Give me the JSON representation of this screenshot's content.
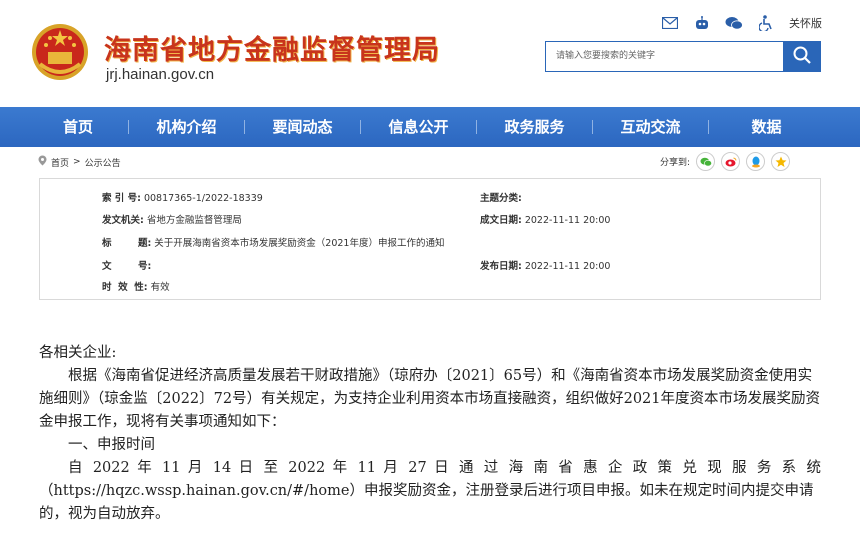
{
  "header": {
    "site_title": "海南省地方金融监督管理局",
    "site_domain": "jrj.hainan.gov.cn",
    "care_label": "关怀版",
    "search_placeholder": "请输入您要搜索的关键字",
    "icons": [
      "mail-icon",
      "robot-icon",
      "wechat-icon",
      "accessibility-icon",
      "search-icon"
    ]
  },
  "nav": {
    "items": [
      "首页",
      "机构介绍",
      "要闻动态",
      "信息公开",
      "政务服务",
      "互动交流",
      "数据"
    ]
  },
  "breadcrumb": {
    "home": "首页",
    "sep": ">",
    "current": "公示公告"
  },
  "share": {
    "label": "分享到:",
    "icons": [
      "wechat-share-icon",
      "weibo-share-icon",
      "qq-share-icon",
      "qzone-share-icon"
    ]
  },
  "meta": {
    "index_label": "索  引  号:",
    "index_value": "00817365-1/2022-18339",
    "topic_label": "主题分类:",
    "topic_value": "",
    "issuer_label": "发文机关:",
    "issuer_value": "省地方金融监督管理局",
    "date_label": "成文日期:",
    "date_value": "2022-11-11 20:00",
    "title_label": "标        题:",
    "title_value": "关于开展海南省资本市场发展奖励资金（2021年度）申报工作的通知",
    "docno_label": "文        号:",
    "docno_value": "",
    "pub_label": "发布日期:",
    "pub_value": "2022-11-11 20:00",
    "valid_label": "时  效  性:",
    "valid_value": "有效"
  },
  "body": {
    "salutation": "各相关企业:",
    "para1": "根据《海南省促进经济高质量发展若干财政措施》（琼府办〔2021〕65号）和《海南省资本市场发展奖励资金使用实施细则》（琼金监〔2022〕72号）有关规定，为支持企业利用资本市场直接融资，组织做好2021年度资本市场发展奖励资金申报工作，现将有关事项通知如下：",
    "section1": "一、申报时间",
    "para2_line1": "自 2022 年 11 月 14 日 至 2022 年 11 月 27 日 通 过 海 南 省 惠 企 政 策 兑 现 服 务 系 统",
    "para2_rest": "（https://hqzc.wssp.hainan.gov.cn/#/home）申报奖励资金，注册登录后进行项目申报。如未在规定时间内提交申请的，视为自动放弃。"
  },
  "colors": {
    "nav_bg": "#2c67c0",
    "title_red": "#c8341c",
    "title_gold": "#f2b64a"
  }
}
